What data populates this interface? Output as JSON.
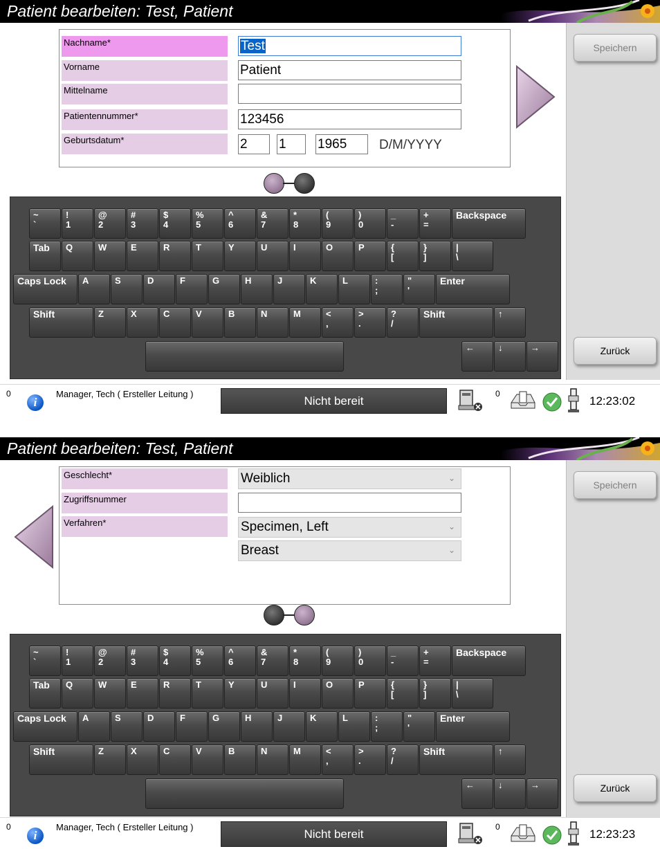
{
  "screens": [
    {
      "title": "Patient bearbeiten: Test, Patient",
      "fields": [
        {
          "label": "Nachname*",
          "value": "Test"
        },
        {
          "label": "Vorname",
          "value": "Patient"
        },
        {
          "label": "Mittelname",
          "value": ""
        },
        {
          "label": "Patientennummer*",
          "value": "123456"
        },
        {
          "label": "Geburtsdatum*",
          "day": "2",
          "month": "1",
          "year": "1965",
          "format": "D/M/YYYY"
        }
      ],
      "save_label": "Speichern",
      "back_label": "Zurück",
      "status": {
        "count": "0",
        "user": "Manager, Tech ( Ersteller Leitung )",
        "state": "Nicht bereit",
        "count2": "0",
        "time": "12:23:02"
      }
    },
    {
      "title": "Patient bearbeiten: Test, Patient",
      "fields": [
        {
          "label": "Geschlecht*",
          "value": "Weiblich"
        },
        {
          "label": "Zugriffsnummer",
          "value": ""
        },
        {
          "label": "Verfahren*",
          "value": "Specimen, Left",
          "value2": "Breast"
        }
      ],
      "save_label": "Speichern",
      "back_label": "Zurück",
      "status": {
        "count": "0",
        "user": "Manager, Tech ( Ersteller Leitung )",
        "state": "Nicht bereit",
        "count2": "0",
        "time": "12:23:23"
      }
    }
  ],
  "keyboard": {
    "row1": [
      "~\n`",
      "!\n1",
      "@\n2",
      "#\n3",
      "$\n4",
      "%\n5",
      "^\n6",
      "&\n7",
      "*\n8",
      "(\n9",
      ")\n0",
      "_\n-",
      "+\n=",
      "Backspace"
    ],
    "row2": [
      "Tab",
      "Q",
      "W",
      "E",
      "R",
      "T",
      "Y",
      "U",
      "I",
      "O",
      "P",
      "{\n[",
      "}\n]",
      "|\n\\"
    ],
    "row3": [
      "Caps Lock",
      "A",
      "S",
      "D",
      "F",
      "G",
      "H",
      "J",
      "K",
      "L",
      ":\n;",
      "\"\n'",
      "Enter"
    ],
    "row4": [
      "Shift",
      "Z",
      "X",
      "C",
      "V",
      "B",
      "N",
      "M",
      "<\n,",
      ">\n.",
      "?\n/",
      "Shift",
      "↑"
    ],
    "row5": [
      "",
      "←",
      "↓",
      "→"
    ]
  },
  "icons": {
    "info": "info-icon",
    "printer": "printer-error-icon",
    "tray": "tray-icon",
    "ok": "check-icon",
    "device": "device-icon",
    "next": "next-arrow-icon",
    "prev": "prev-arrow-icon"
  },
  "colors": {
    "label_bg": "#e6cde6",
    "label_active": "#ee99ee",
    "title_bg": "#000000",
    "keyboard_bg": "#484848"
  }
}
